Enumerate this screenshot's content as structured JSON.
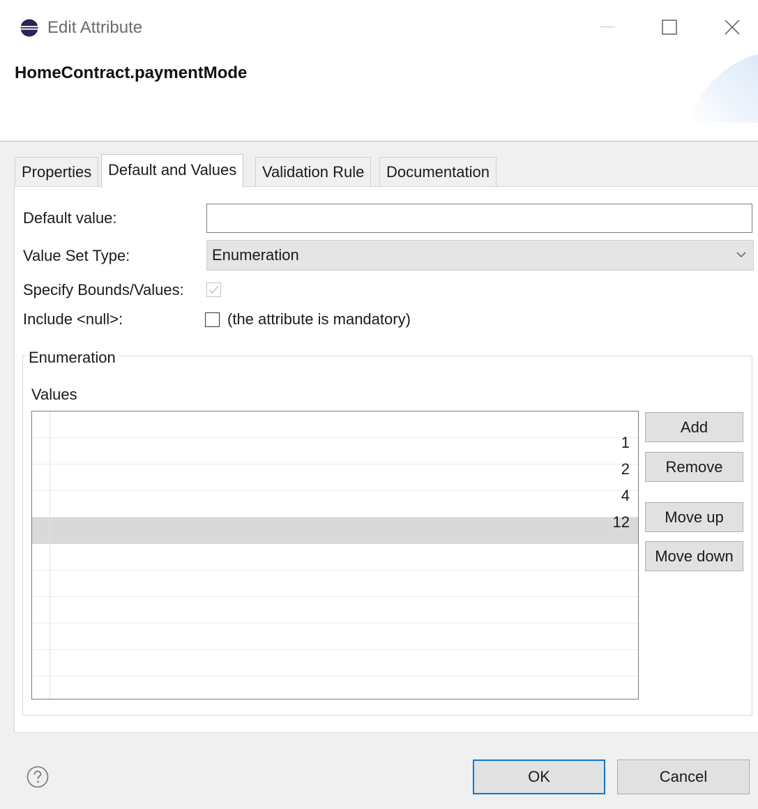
{
  "window": {
    "title": "Edit Attribute",
    "icons": {
      "app": "eclipse-icon",
      "minimize": "minimize-icon",
      "maximize": "maximize-icon",
      "close": "close-icon"
    }
  },
  "header": {
    "title": "HomeContract.paymentMode"
  },
  "tabs": [
    {
      "label": "Properties",
      "active": false
    },
    {
      "label": "Default and Values",
      "active": true
    },
    {
      "label": "Validation Rule",
      "active": false
    },
    {
      "label": "Documentation",
      "active": false
    }
  ],
  "form": {
    "default_value_label": "Default value:",
    "default_value": "",
    "value_set_type_label": "Value Set Type:",
    "value_set_type": "Enumeration",
    "specify_bounds_label": "Specify Bounds/Values:",
    "specify_bounds_checked": true,
    "specify_bounds_enabled": false,
    "include_null_label": "Include <null>:",
    "include_null_checked": false,
    "include_null_hint": "(the attribute is mandatory)"
  },
  "enumeration": {
    "group_label": "Enumeration",
    "values_label": "Values",
    "rows": [
      "",
      "1",
      "2",
      "4",
      "12",
      "",
      "",
      "",
      "",
      ""
    ],
    "selected_row": 4,
    "buttons": {
      "add": "Add",
      "remove": "Remove",
      "move_up": "Move up",
      "move_down": "Move down"
    }
  },
  "footer": {
    "help_icon": "help-icon",
    "ok": "OK",
    "cancel": "Cancel"
  },
  "colors": {
    "accent": "#0078d7",
    "selected_row": "#d9d9d9",
    "combo_bg": "#e5e5e5"
  }
}
